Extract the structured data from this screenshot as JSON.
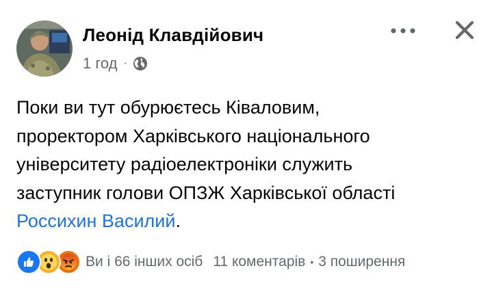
{
  "post": {
    "author": "Леонід Клавдійович",
    "timestamp": "1 год",
    "meta_separator": "·",
    "privacy_icon": "globe-icon",
    "text_lines": [
      "Поки ви тут обурюєтесь Ківаловим,",
      "проректором Харківського національного",
      "університету радіоелектроніки служить",
      "заступник голови ОПЗЖ Харківської області"
    ],
    "mention": "Россихин Василий",
    "text_end": ".",
    "actions": {
      "more_icon": "more-options-icon",
      "close_icon": "close-icon"
    }
  },
  "footer": {
    "reactions": [
      "like",
      "wow",
      "angry"
    ],
    "reaction_summary": "Ви і 66 інших осіб",
    "comments": "11 коментарів",
    "separator": "•",
    "shares": "3 поширення"
  },
  "colors": {
    "text": "#050505",
    "secondary": "#65676b",
    "link": "#1b74e4",
    "like": "#1877f2",
    "wow": "#f7b125",
    "angry": "#e9710f"
  }
}
